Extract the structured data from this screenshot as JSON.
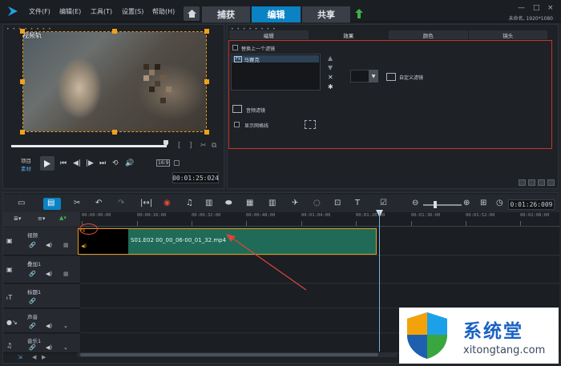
{
  "menubar": {
    "items": [
      "文件(F)",
      "编辑(E)",
      "工具(T)",
      "设置(S)",
      "帮助(H)"
    ],
    "tabs": [
      "捕获",
      "编辑",
      "共享"
    ],
    "active_tab": "编辑",
    "window_controls": [
      "—",
      "□",
      "×"
    ],
    "project_info": "未命名, 1920*1080"
  },
  "preview": {
    "track_label": "视频轨",
    "project_label": "项目",
    "clip_label": "素材",
    "ratio": "16:9",
    "timecode": "00:01:25:024"
  },
  "effects": {
    "tabs": [
      "编辑",
      "效果",
      "颜色",
      "镜头"
    ],
    "active_tab": "效果",
    "replace_prev_filter": "替换上一个滤镜",
    "filter_item": "马赛克",
    "filter_badge": "FX",
    "custom_filter": "自定义滤镜",
    "audio_filter": "音频滤镜",
    "show_grid": "显示网格线"
  },
  "timeline": {
    "timecode": "0:01:26:009",
    "ruler": [
      "00:00:00:00",
      "00:00:16:00",
      "00:00:32:00",
      "00:00:48:00",
      "00:01:04:00",
      "00:01:20:00",
      "00:01:36:00",
      "00:01:52:00",
      "00:02:08:00"
    ],
    "tracks": [
      {
        "name": "视频",
        "icon": "▣"
      },
      {
        "name": "叠加1",
        "icon": "▣"
      },
      {
        "name": "标题1",
        "icon": "T"
      },
      {
        "name": "声音",
        "icon": "♪"
      },
      {
        "name": "音乐1",
        "icon": "♫"
      }
    ],
    "clip": {
      "name": "S01.E02 00_00_06-00_01_32.mp4",
      "fx": "FX"
    }
  },
  "watermark": {
    "title": "系统堂",
    "url": "xitongtang.com"
  },
  "colors": {
    "accent": "#0a82c4",
    "clip": "#1f6b57",
    "clip_border": "#e39a1f",
    "annotation": "#e04a3c"
  }
}
